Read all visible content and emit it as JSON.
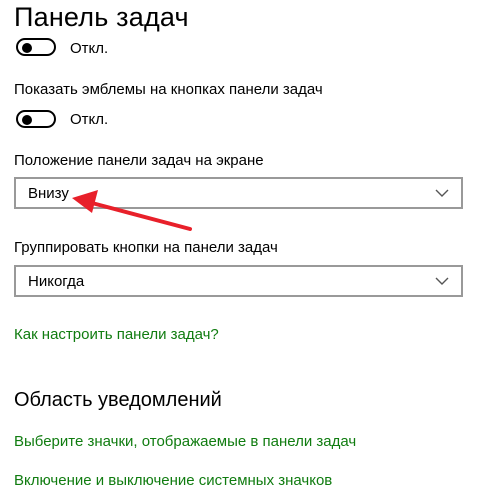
{
  "page_title": "Панель задач",
  "toggle_top": {
    "state_label": "Откл.",
    "on": false
  },
  "badges": {
    "label": "Показать эмблемы на кнопках панели задач",
    "state_label": "Откл.",
    "on": false
  },
  "taskbar_location": {
    "label": "Положение панели задач на экране",
    "selected": "Внизу"
  },
  "combine_buttons": {
    "label": "Группировать кнопки на панели задач",
    "selected": "Никогда"
  },
  "customize_link": "Как настроить панели задач?",
  "notification_area": {
    "title": "Область уведомлений",
    "link_select_icons": "Выберите значки, отображаемые в панели задач",
    "link_system_icons": "Включение и выключение системных значков"
  },
  "colors": {
    "link": "#107c10",
    "annotation_arrow": "#e8202a"
  },
  "icons": {
    "dropdown": "chevron-down-icon",
    "annotation": "red-arrow-annotation"
  }
}
